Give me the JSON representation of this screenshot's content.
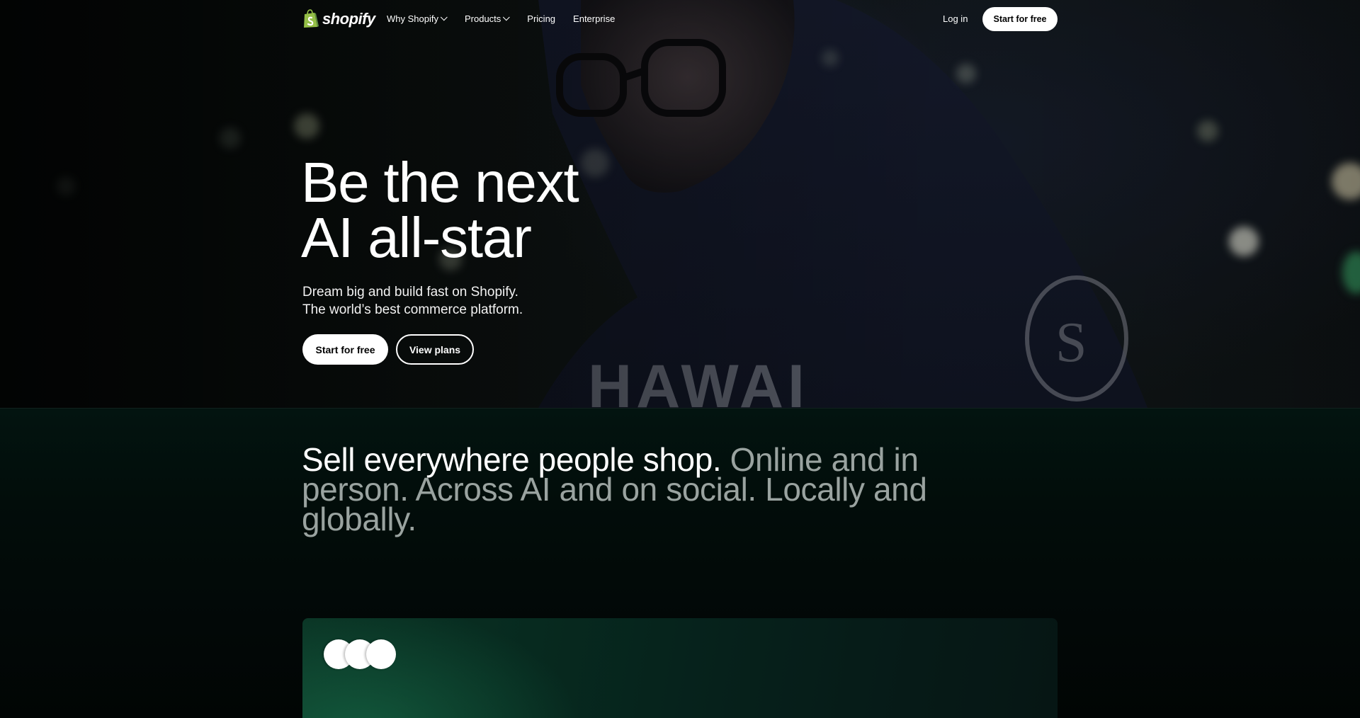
{
  "brand": {
    "name": "shopify",
    "color": "#95bf47"
  },
  "nav": {
    "links": [
      {
        "label": "Why Shopify",
        "dropdown": true
      },
      {
        "label": "Products",
        "dropdown": true
      },
      {
        "label": "Pricing",
        "dropdown": false
      },
      {
        "label": "Enterprise",
        "dropdown": false
      }
    ],
    "login": "Log in",
    "cta": "Start for free"
  },
  "hero": {
    "title_line1": "Be the next",
    "title_line2": "AI all-star",
    "subtitle_line1": "Dream big and build fast on Shopify.",
    "subtitle_line2": "The world’s best commerce platform.",
    "primary_button": "Start for free",
    "secondary_button": "View plans"
  },
  "sell": {
    "heading_strong": "Sell everywhere people shop.",
    "heading_muted": "Online and in person. Across AI and on social. Locally and globally."
  }
}
